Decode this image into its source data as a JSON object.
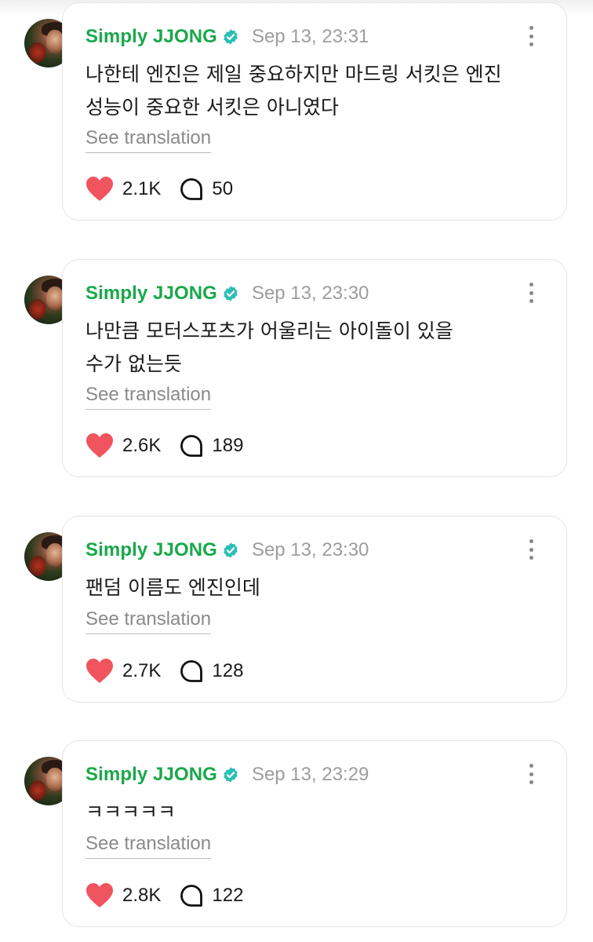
{
  "colors": {
    "username": "#19a84a",
    "verified_badge": "#2bbfb5",
    "timestamp": "#9d9d9d",
    "like_heart": "#f0545e"
  },
  "posts": [
    {
      "author": "Simply JJONG",
      "timestamp": "Sep 13, 23:31",
      "text_lines": [
        "나한테 엔진은 제일 중요하지만 마드링 서킷은 엔진",
        "성능이 중요한 서킷은 아니였다"
      ],
      "see_translation": "See translation",
      "likes": "2.1K",
      "comments": "50"
    },
    {
      "author": "Simply JJONG",
      "timestamp": "Sep 13, 23:30",
      "text_lines": [
        "나만큼 모터스포츠가 어울리는 아이돌이 있을",
        "수가 없는듯"
      ],
      "see_translation": "See translation",
      "likes": "2.6K",
      "comments": "189"
    },
    {
      "author": "Simply JJONG",
      "timestamp": "Sep 13, 23:30",
      "text_lines": [
        "팬덤 이름도 엔진인데"
      ],
      "see_translation": "See translation",
      "likes": "2.7K",
      "comments": "128"
    },
    {
      "author": "Simply JJONG",
      "timestamp": "Sep 13, 23:29",
      "text_lines": [
        "ㅋㅋㅋㅋㅋ"
      ],
      "see_translation": "See translation",
      "likes": "2.8K",
      "comments": "122"
    }
  ],
  "icons": {
    "avatar": "profile-photo",
    "verified": "verified-check-icon",
    "more": "more-vertical-icon",
    "like": "heart-icon",
    "comment": "speech-bubble-icon"
  }
}
